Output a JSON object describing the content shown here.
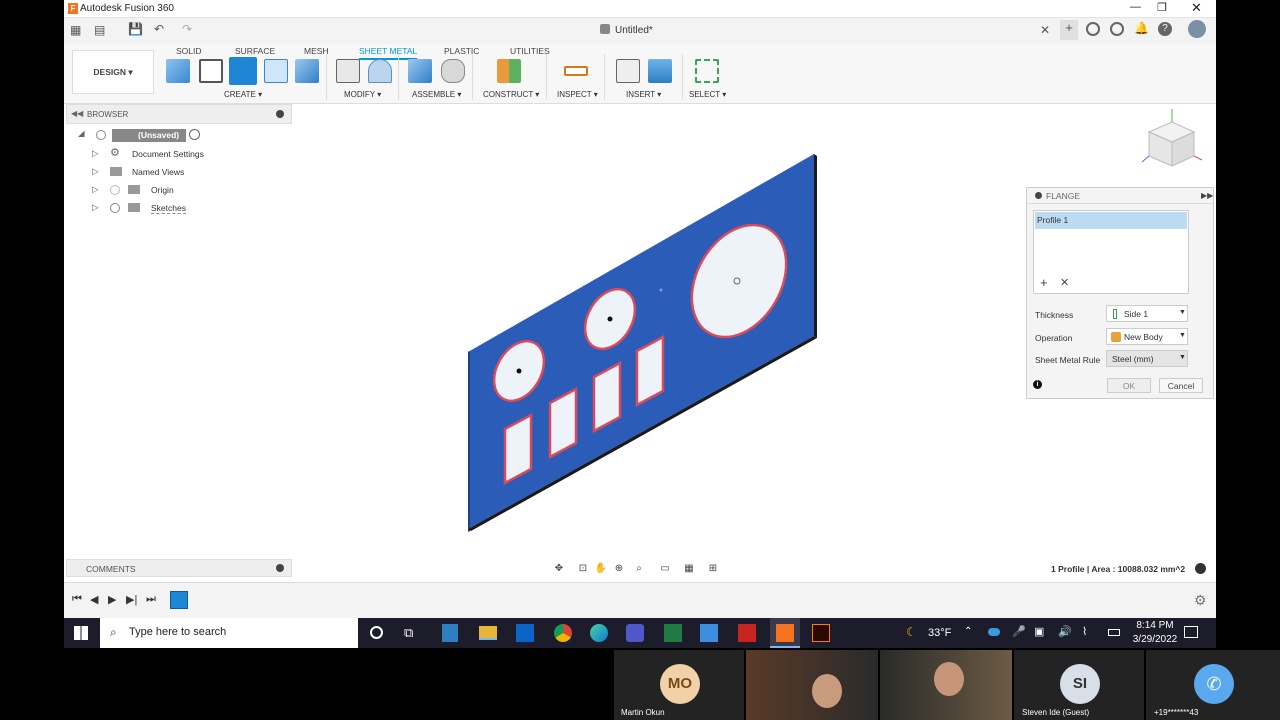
{
  "window": {
    "title": "Autodesk Fusion 360",
    "doc_title": "Untitled*"
  },
  "ribbon": {
    "workspace": "DESIGN ▾",
    "tabs": [
      "SOLID",
      "SURFACE",
      "MESH",
      "SHEET METAL",
      "PLASTIC",
      "UTILITIES"
    ],
    "active_tab": "SHEET METAL",
    "groups": [
      "CREATE ▾",
      "MODIFY ▾",
      "ASSEMBLE ▾",
      "CONSTRUCT ▾",
      "INSPECT ▾",
      "INSERT ▾",
      "SELECT ▾"
    ]
  },
  "browser": {
    "title": "BROWSER",
    "root": "(Unsaved)",
    "items": [
      "Document Settings",
      "Named Views",
      "Origin",
      "Sketches"
    ]
  },
  "comments": {
    "title": "COMMENTS"
  },
  "status": {
    "profile_area": "1 Profile | Area : 10088.032 mm^2"
  },
  "flange": {
    "title": "FLANGE",
    "profile_item": "Profile 1",
    "thickness_label": "Thickness",
    "thickness_value": "Side 1",
    "operation_label": "Operation",
    "operation_value": "New Body",
    "rule_label": "Sheet Metal Rule",
    "rule_value": "Steel (mm)",
    "ok_label": "OK",
    "cancel_label": "Cancel"
  },
  "taskbar": {
    "search_placeholder": "Type here to search",
    "weather": "33°F",
    "time": "8:14 PM",
    "date": "3/29/2022"
  },
  "participants": {
    "p1_initials": "MO",
    "p1_name": "Martin Okun",
    "p2_initials": "SI",
    "p2_name": "Steven Ide (Guest)",
    "p3_name": "+19*******43"
  },
  "colors": {
    "accent": "#0696d7",
    "panel_blue": "#2e5fb5",
    "cutout_red": "#d94a5a"
  }
}
